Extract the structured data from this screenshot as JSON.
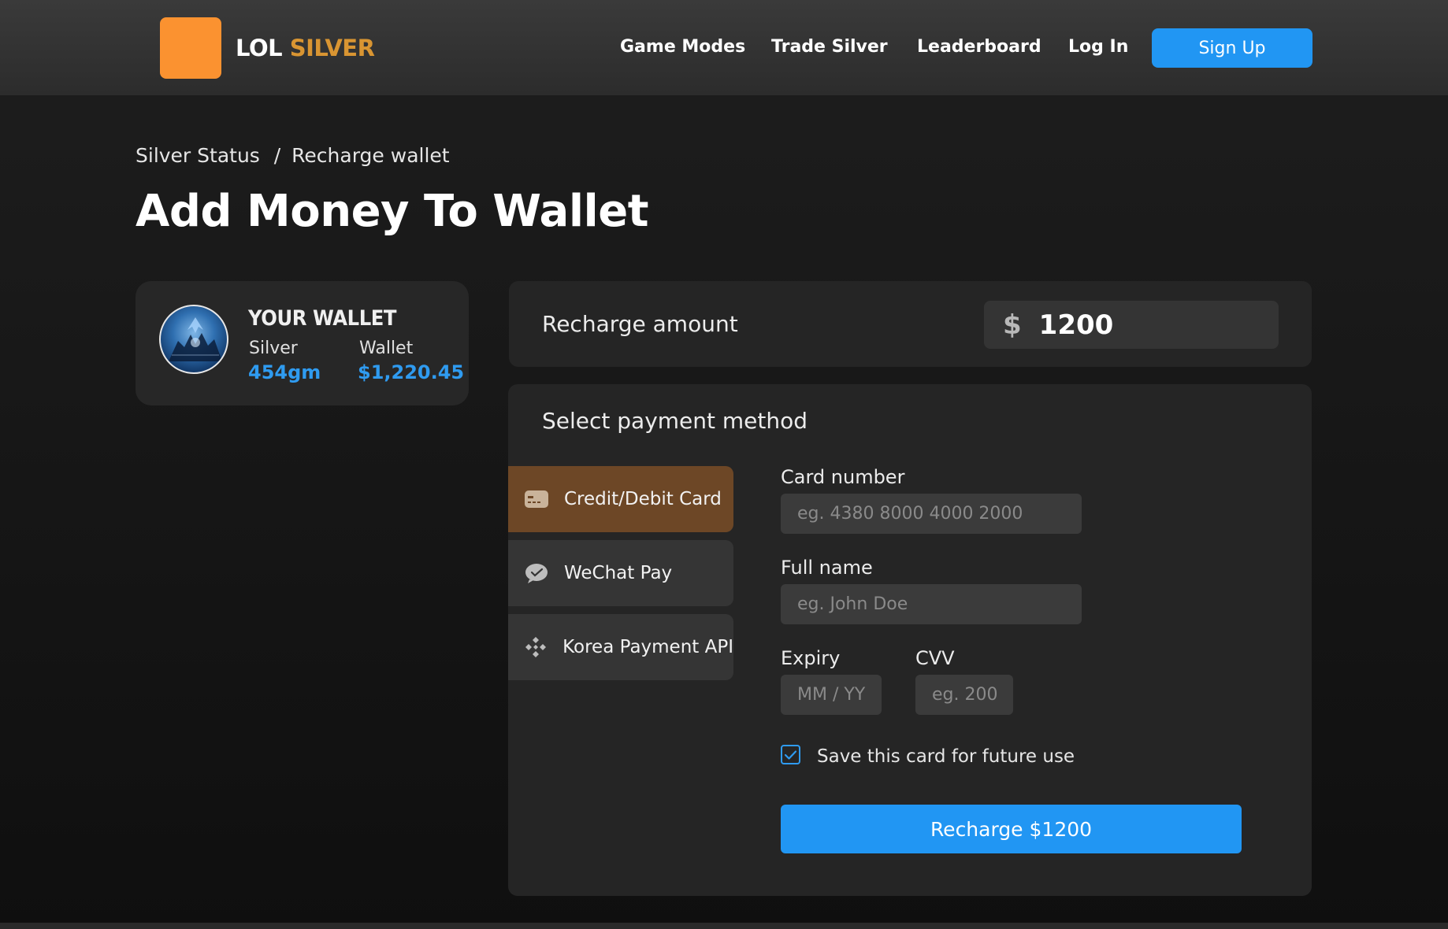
{
  "header": {
    "logo_word1": "LOL",
    "logo_word2": "SILVER",
    "nav": [
      "Game Modes",
      "Trade Silver",
      "Leaderboard",
      "Log In"
    ],
    "signup_label": "Sign Up"
  },
  "breadcrumb": {
    "parent": "Silver Status",
    "separator": "/",
    "current": "Recharge wallet"
  },
  "page_title": "Add Money To Wallet",
  "wallet": {
    "title": "YOUR WALLET",
    "silver_label": "Silver",
    "silver_value": "454gm",
    "wallet_label": "Wallet",
    "wallet_value": "$1,220.45"
  },
  "recharge": {
    "label": "Recharge amount",
    "currency_symbol": "$",
    "amount": "1200"
  },
  "payment": {
    "title": "Select payment method",
    "methods": [
      {
        "label": "Credit/Debit Card",
        "icon": "credit-card-icon",
        "active": true
      },
      {
        "label": "WeChat Pay",
        "icon": "wechat-icon",
        "active": false
      },
      {
        "label": "Korea Payment API",
        "icon": "diamond-grid-icon",
        "active": false
      }
    ],
    "form": {
      "card_number_label": "Card number",
      "card_number_placeholder": "eg. 4380 8000 4000 2000",
      "full_name_label": "Full name",
      "full_name_placeholder": "eg. John Doe",
      "expiry_label": "Expiry",
      "expiry_placeholder": "MM / YY",
      "cvv_label": "CVV",
      "cvv_placeholder": "eg. 200",
      "save_card_label": "Save this card for future use",
      "save_card_checked": true,
      "submit_label": "Recharge $1200"
    }
  },
  "colors": {
    "accent_blue": "#2196f3",
    "value_blue": "#2f9bf0",
    "logo_orange": "#fb9230",
    "logo_gold": "#d99532",
    "active_method": "#6d4726"
  }
}
